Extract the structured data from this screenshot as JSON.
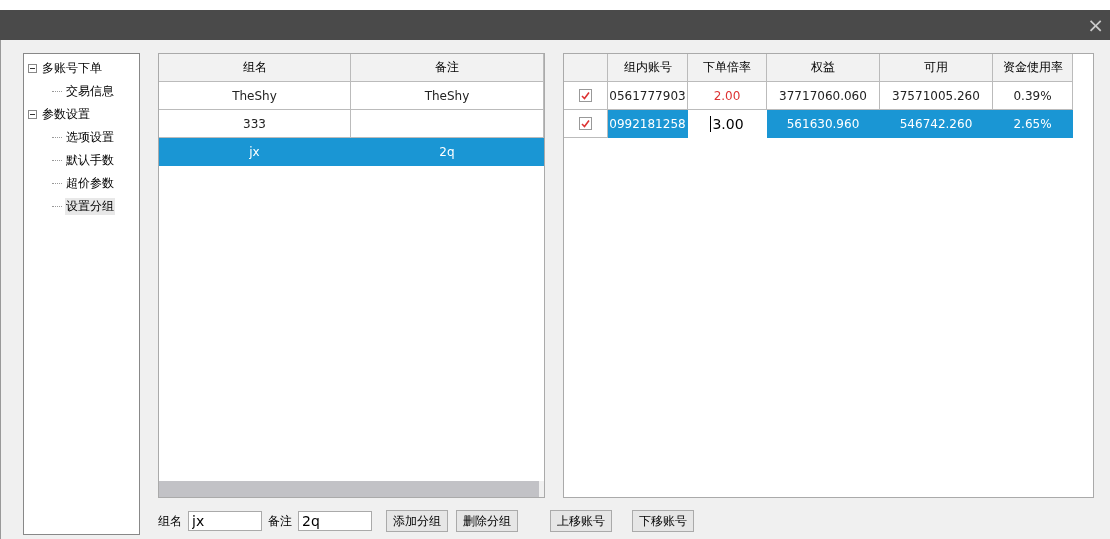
{
  "window": {
    "close": "×"
  },
  "tree": [
    {
      "label": "多账号下单",
      "expanded": true,
      "selected": false,
      "children": [
        {
          "label": "交易信息",
          "selected": false
        }
      ]
    },
    {
      "label": "参数设置",
      "expanded": true,
      "selected": false,
      "children": [
        {
          "label": "选项设置",
          "selected": false
        },
        {
          "label": "默认手数",
          "selected": false
        },
        {
          "label": "超价参数",
          "selected": false
        },
        {
          "label": "设置分组",
          "selected": true
        }
      ]
    }
  ],
  "groups_table": {
    "columns": [
      "组名",
      "备注"
    ],
    "rows": [
      {
        "cells": [
          "TheShy",
          "TheShy"
        ],
        "selected": false
      },
      {
        "cells": [
          "333",
          ""
        ],
        "selected": false
      },
      {
        "cells": [
          "jx",
          "2q"
        ],
        "selected": true
      }
    ]
  },
  "accounts_table": {
    "columns": [
      "组内账号",
      "下单倍率",
      "权益",
      "可用",
      "资金使用率"
    ],
    "rows": [
      {
        "checked": true,
        "selected": false,
        "editing": false,
        "account": "0561777903",
        "rate": "2.00",
        "equity": "37717060.060",
        "available": "37571005.260",
        "usage": "0.39%"
      },
      {
        "checked": true,
        "selected": true,
        "editing": true,
        "account": "0992181258",
        "rate": "3.00",
        "equity": "561630.960",
        "available": "546742.260",
        "usage": "2.65%"
      }
    ]
  },
  "form": {
    "name_label": "组名",
    "name_value": "jx",
    "note_label": "备注",
    "note_value": "2q"
  },
  "buttons": [
    "添加分组",
    "删除分组",
    "上移账号",
    "下移账号"
  ]
}
